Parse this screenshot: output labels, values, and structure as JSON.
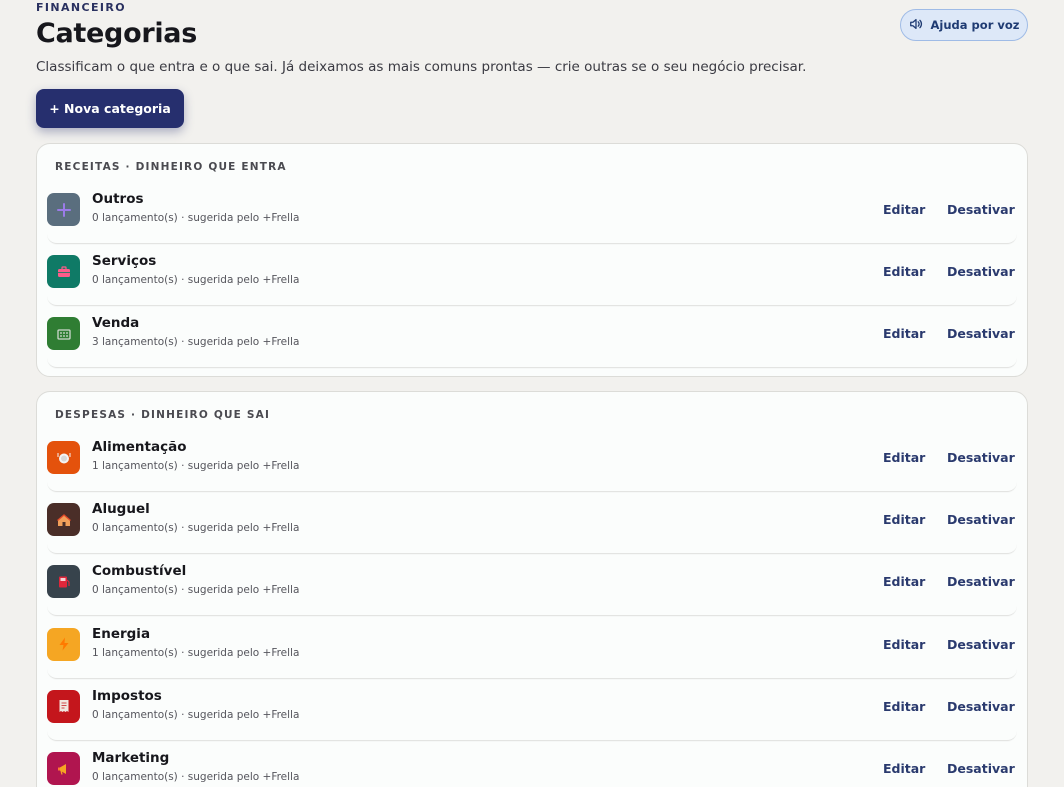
{
  "header": {
    "eyebrow": "FINANCEIRO",
    "title": "Categorias",
    "subtitle": "Classificam o que entra e o que sai. Já deixamos as mais comuns prontas — crie outras se o seu negócio precisar.",
    "voice_label": "Ajuda por voz",
    "new_label": "+ Nova categoria"
  },
  "actions": {
    "edit": "Editar",
    "deactivate": "Desativar"
  },
  "income": {
    "heading": "RECEITAS · DINHEIRO QUE ENTRA",
    "items": [
      {
        "name": "Outros",
        "meta": "0 lançamento(s) · sugerida pelo +Frella",
        "icon": "plus-icon",
        "color": "#5a6e7e",
        "glyph": "#9b7be8"
      },
      {
        "name": "Serviços",
        "meta": "0 lançamento(s) · sugerida pelo +Frella",
        "icon": "briefcase-icon",
        "color": "#0f7a66",
        "glyph": "#ff5c8a"
      },
      {
        "name": "Venda",
        "meta": "3 lançamento(s) · sugerida pelo +Frella",
        "icon": "cash-register-icon",
        "color": "#2f7d33",
        "glyph": "#cfd8cf"
      }
    ]
  },
  "expense": {
    "heading": "DESPESAS · DINHEIRO QUE SAI",
    "items": [
      {
        "name": "Alimentação",
        "meta": "1 lançamento(s) · sugerida pelo +Frella",
        "icon": "plate-icon",
        "color": "#e4520c",
        "glyph": "#f4f4f4"
      },
      {
        "name": "Aluguel",
        "meta": "0 lançamento(s) · sugerida pelo +Frella",
        "icon": "house-icon",
        "color": "#4a2e28",
        "glyph": "#f2a05a"
      },
      {
        "name": "Combustível",
        "meta": "0 lançamento(s) · sugerida pelo +Frella",
        "icon": "fuel-pump-icon",
        "color": "#37434c",
        "glyph": "#e0263a"
      },
      {
        "name": "Energia",
        "meta": "1 lançamento(s) · sugerida pelo +Frella",
        "icon": "lightning-icon",
        "color": "#f5a623",
        "glyph": "#ff7a00"
      },
      {
        "name": "Impostos",
        "meta": "0 lançamento(s) · sugerida pelo +Frella",
        "icon": "receipt-icon",
        "color": "#c4161c",
        "glyph": "#f1e6e0"
      },
      {
        "name": "Marketing",
        "meta": "0 lançamento(s) · sugerida pelo +Frella",
        "icon": "megaphone-icon",
        "color": "#b0154f",
        "glyph": "#f5a623"
      }
    ]
  }
}
